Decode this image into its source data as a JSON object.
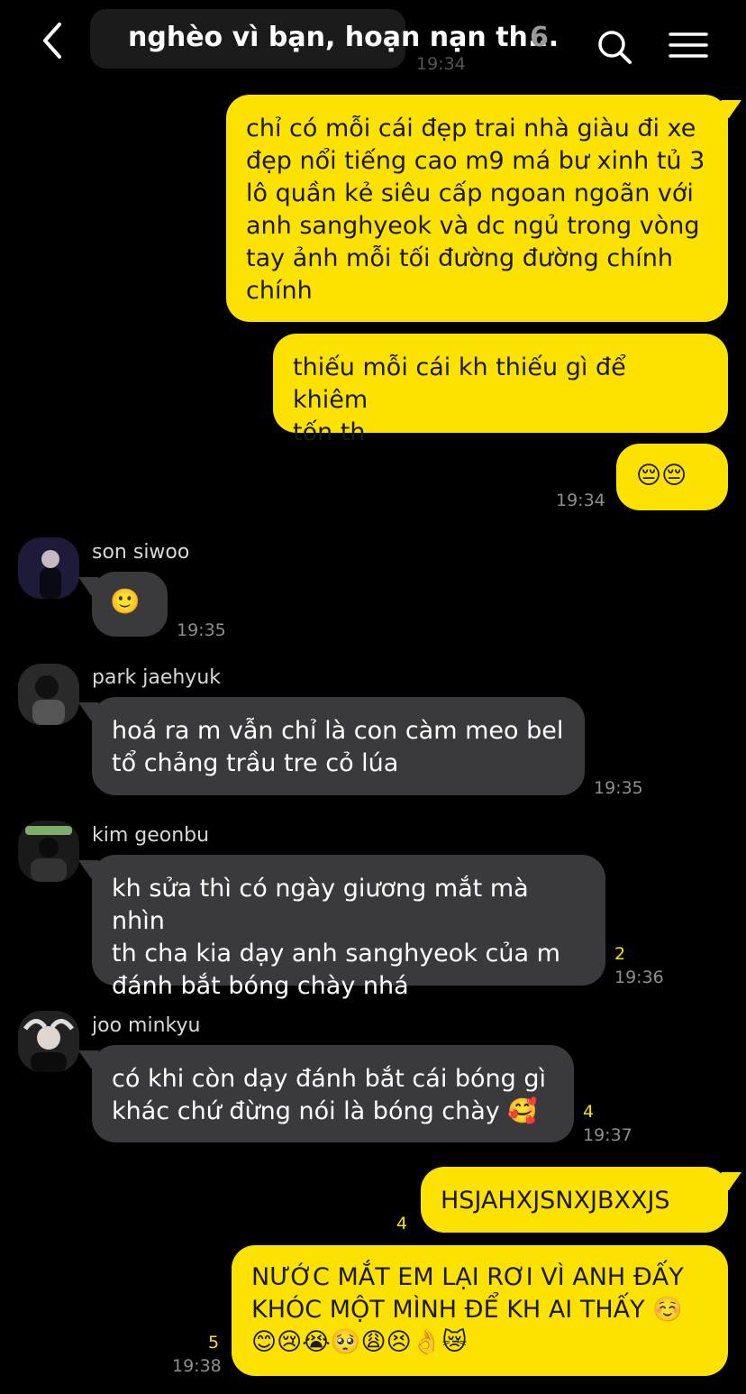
{
  "header": {
    "title": "nghèo vì bạn, hoạn nạn th...",
    "member_count": "6",
    "back_icon": "chevron-left-icon",
    "search_icon": "search-icon",
    "menu_icon": "menu-icon"
  },
  "background_ghost": {
    "time": "19:34"
  },
  "messages": [
    {
      "sender": "me",
      "text": "chỉ có mỗi cái đẹp trai nhà giàu đi xe\nđẹp nổi tiếng cao m9 má bư xinh tủ 3\nlô quần kẻ siêu cấp ngoan ngoãn với\nanh sanghyeok và dc ngủ trong vòng\ntay ảnh mỗi tối đường đường chính\nchính"
    },
    {
      "sender": "me",
      "text": "thiếu mỗi cái kh thiếu gì để khiêm\ntốn th"
    },
    {
      "sender": "me",
      "text": "😔😔",
      "time": "19:34"
    },
    {
      "sender": "son siwoo",
      "name": "son siwoo",
      "text": "🙂",
      "time": "19:35"
    },
    {
      "sender": "park jaehyuk",
      "name": "park jaehyuk",
      "text": "hoá ra m vẫn chỉ là con càm meo bel\ntổ chảng trầu tre cỏ lúa",
      "time": "19:35"
    },
    {
      "sender": "kim geonbu",
      "name": "kim geonbu",
      "text": "kh sửa thì có ngày giương mắt mà nhìn\nth cha kia dạy anh sanghyeok của m\nđánh bắt bóng chày nhá",
      "unread": "2",
      "time": "19:36"
    },
    {
      "sender": "joo minkyu",
      "name": "joo minkyu",
      "text": "có khi còn dạy đánh bắt cái bóng gì\nkhác chứ đừng nói là bóng chày 🥰",
      "unread": "4",
      "time": "19:37"
    },
    {
      "sender": "me",
      "text": "HSJAHXJSNXJBXXJS",
      "unread": "4"
    },
    {
      "sender": "me",
      "text": "NƯỚC MẮT EM LẠI RƠI VÌ ANH ĐẤY\nKHÓC MỘT MÌNH ĐỂ KH AI THẤY ☺️\n😊😢😭🥺😩😣👌😿",
      "unread": "5",
      "time": "19:38"
    }
  ],
  "colors": {
    "background": "#000000",
    "my_bubble": "#fde200",
    "their_bubble": "#3a3a3c",
    "unread_count": "#fde200",
    "timestamp": "#8e8e93"
  }
}
